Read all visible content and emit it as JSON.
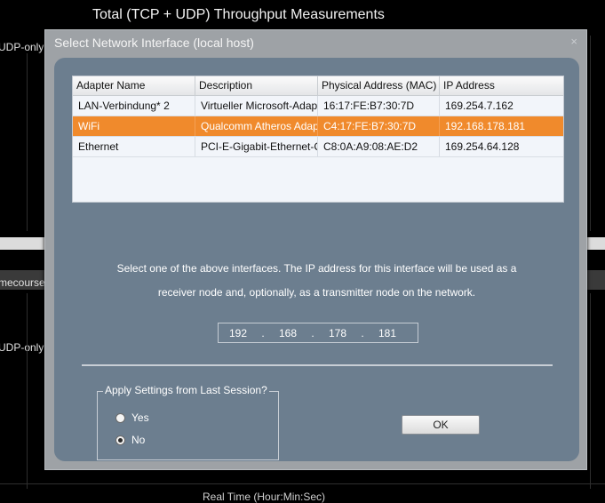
{
  "background": {
    "chart_title": "Total (TCP + UDP) Throughput Measurements",
    "label_top": "UDP-only",
    "label_mid": "UDP-only",
    "label_timecourse": "mecourse (",
    "bottom_axis_partial": "Real Time (Hour:Min:Sec)"
  },
  "dialog": {
    "title": "Select Network Interface (local host)",
    "close_glyph": "×"
  },
  "table": {
    "headers": [
      "Adapter Name",
      "Description",
      "Physical Address (MAC)",
      "IP Address"
    ],
    "rows": [
      {
        "adapter": "LAN-Verbindung* 2",
        "description": "Virtueller Microsoft-Adapter",
        "mac": "16:17:FE:B7:30:7D",
        "ip": "169.254.7.162",
        "selected": false
      },
      {
        "adapter": "WiFi",
        "description": "Qualcomm Atheros Adapter",
        "mac": "C4:17:FE:B7:30:7D",
        "ip": "192.168.178.181",
        "selected": true
      },
      {
        "adapter": "Ethernet",
        "description": "PCI-E-Gigabit-Ethernet-Controller",
        "mac": "C8:0A:A9:08:AE:D2",
        "ip": "169.254.64.128",
        "selected": false
      }
    ]
  },
  "instructions": {
    "line1": "Select one of the above interfaces.  The IP address for this interface will be used as a",
    "line2": "receiver node and, optionally, as a transmitter node on the network."
  },
  "ip_field": {
    "octets": [
      "192",
      "168",
      "178",
      "181"
    ],
    "separator": "."
  },
  "settings_group": {
    "legend": "Apply Settings from Last Session?",
    "yes_label": "Yes",
    "no_label": "No",
    "selected": "No"
  },
  "ok_button": {
    "label": "OK"
  },
  "colors": {
    "selection": "#f08a2c",
    "dialog_client": "#6c7e8f",
    "dialog_frame": "#9ea2a6"
  }
}
